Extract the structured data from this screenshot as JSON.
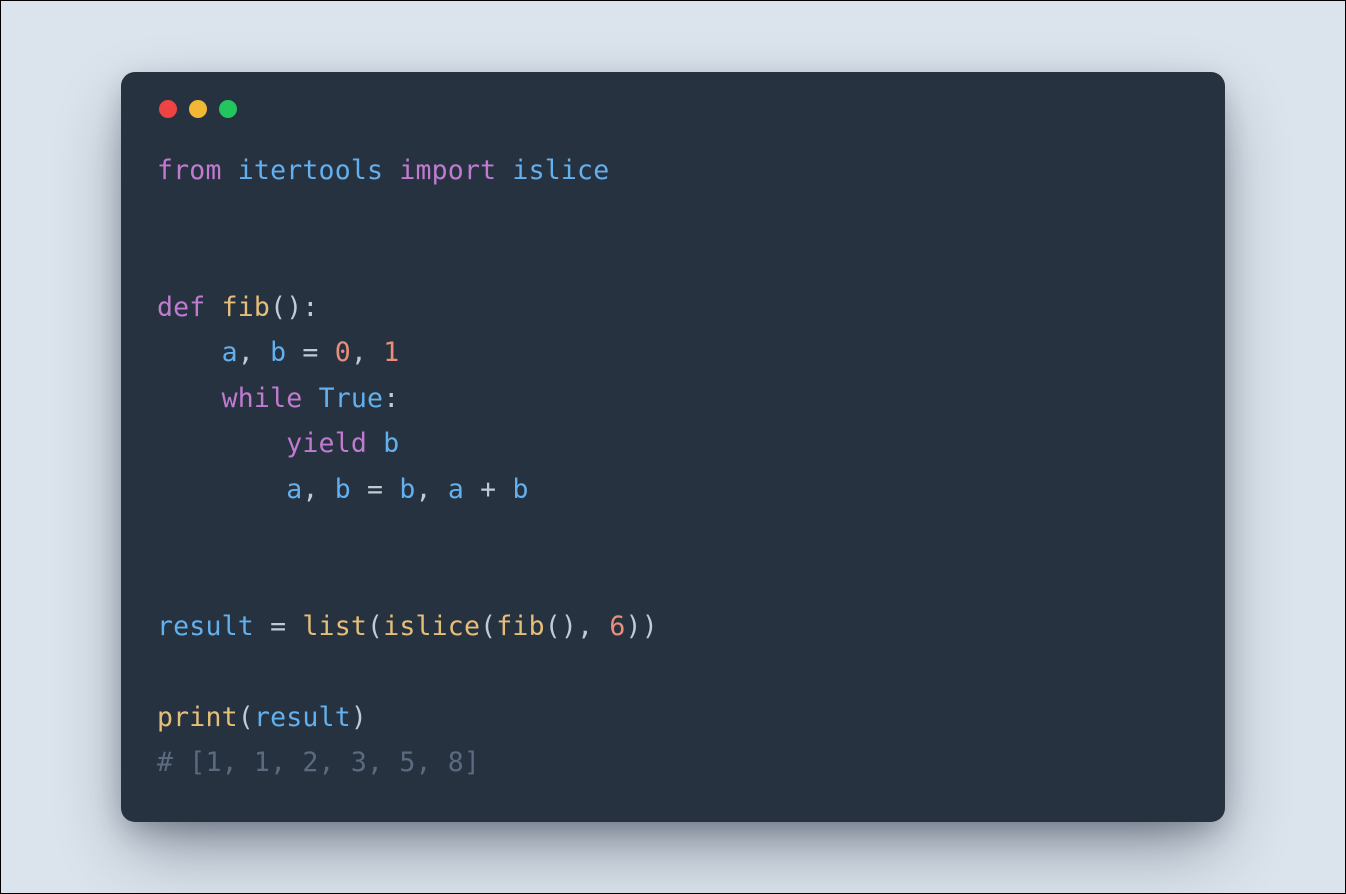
{
  "window": {
    "traffic_lights": [
      "red",
      "yellow",
      "green"
    ]
  },
  "code": {
    "language": "python",
    "tokens": [
      [
        {
          "t": "from",
          "c": "kw"
        },
        {
          "t": " ",
          "c": "pu"
        },
        {
          "t": "itertools",
          "c": "id"
        },
        {
          "t": " ",
          "c": "pu"
        },
        {
          "t": "import",
          "c": "kw"
        },
        {
          "t": " ",
          "c": "pu"
        },
        {
          "t": "islice",
          "c": "id"
        }
      ],
      [],
      [],
      [
        {
          "t": "def",
          "c": "kw"
        },
        {
          "t": " ",
          "c": "pu"
        },
        {
          "t": "fib",
          "c": "fn"
        },
        {
          "t": "(",
          "c": "pu"
        },
        {
          "t": ")",
          "c": "pu"
        },
        {
          "t": ":",
          "c": "pu"
        }
      ],
      [
        {
          "t": "    ",
          "c": "pu"
        },
        {
          "t": "a",
          "c": "id"
        },
        {
          "t": ",",
          "c": "pu"
        },
        {
          "t": " ",
          "c": "pu"
        },
        {
          "t": "b",
          "c": "id"
        },
        {
          "t": " ",
          "c": "pu"
        },
        {
          "t": "=",
          "c": "op"
        },
        {
          "t": " ",
          "c": "pu"
        },
        {
          "t": "0",
          "c": "co"
        },
        {
          "t": ",",
          "c": "pu"
        },
        {
          "t": " ",
          "c": "pu"
        },
        {
          "t": "1",
          "c": "co"
        }
      ],
      [
        {
          "t": "    ",
          "c": "pu"
        },
        {
          "t": "while",
          "c": "kw"
        },
        {
          "t": " ",
          "c": "pu"
        },
        {
          "t": "True",
          "c": "id"
        },
        {
          "t": ":",
          "c": "pu"
        }
      ],
      [
        {
          "t": "        ",
          "c": "pu"
        },
        {
          "t": "yield",
          "c": "kw"
        },
        {
          "t": " ",
          "c": "pu"
        },
        {
          "t": "b",
          "c": "id"
        }
      ],
      [
        {
          "t": "        ",
          "c": "pu"
        },
        {
          "t": "a",
          "c": "id"
        },
        {
          "t": ",",
          "c": "pu"
        },
        {
          "t": " ",
          "c": "pu"
        },
        {
          "t": "b",
          "c": "id"
        },
        {
          "t": " ",
          "c": "pu"
        },
        {
          "t": "=",
          "c": "op"
        },
        {
          "t": " ",
          "c": "pu"
        },
        {
          "t": "b",
          "c": "id"
        },
        {
          "t": ",",
          "c": "pu"
        },
        {
          "t": " ",
          "c": "pu"
        },
        {
          "t": "a",
          "c": "id"
        },
        {
          "t": " ",
          "c": "pu"
        },
        {
          "t": "+",
          "c": "op"
        },
        {
          "t": " ",
          "c": "pu"
        },
        {
          "t": "b",
          "c": "id"
        }
      ],
      [],
      [],
      [
        {
          "t": "result",
          "c": "id"
        },
        {
          "t": " ",
          "c": "pu"
        },
        {
          "t": "=",
          "c": "op"
        },
        {
          "t": " ",
          "c": "pu"
        },
        {
          "t": "list",
          "c": "fn"
        },
        {
          "t": "(",
          "c": "pu"
        },
        {
          "t": "islice",
          "c": "fn"
        },
        {
          "t": "(",
          "c": "pu"
        },
        {
          "t": "fib",
          "c": "fn"
        },
        {
          "t": "(",
          "c": "pu"
        },
        {
          "t": ")",
          "c": "pu"
        },
        {
          "t": ",",
          "c": "pu"
        },
        {
          "t": " ",
          "c": "pu"
        },
        {
          "t": "6",
          "c": "co"
        },
        {
          "t": ")",
          "c": "pu"
        },
        {
          "t": ")",
          "c": "pu"
        }
      ],
      [],
      [
        {
          "t": "print",
          "c": "fn"
        },
        {
          "t": "(",
          "c": "pu"
        },
        {
          "t": "result",
          "c": "id"
        },
        {
          "t": ")",
          "c": "pu"
        }
      ],
      [
        {
          "t": "# [1, 1, 2, 3, 5, 8]",
          "c": "cm"
        }
      ]
    ]
  }
}
